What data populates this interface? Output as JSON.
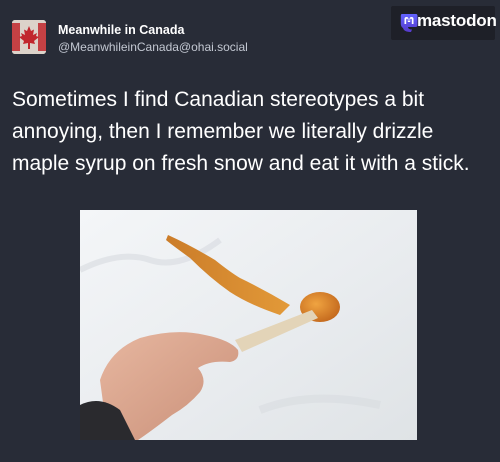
{
  "author": {
    "display_name": "Meanwhile in Canada",
    "handle": "@MeanwhileinCanada@ohai.social",
    "avatar_icon": "canada-flag-icon"
  },
  "brand": {
    "name": "mastodon",
    "logo_icon": "mastodon-logo-icon",
    "accent_color": "#6364ff"
  },
  "post": {
    "lines": [
      "Sometimes I find Canadian stereotypes a bit",
      "annoying, then I remember we  literally drizzle",
      "maple syrup on fresh snow and eat it with a stick."
    ],
    "image": "maple-taffy-on-snow-photo"
  }
}
